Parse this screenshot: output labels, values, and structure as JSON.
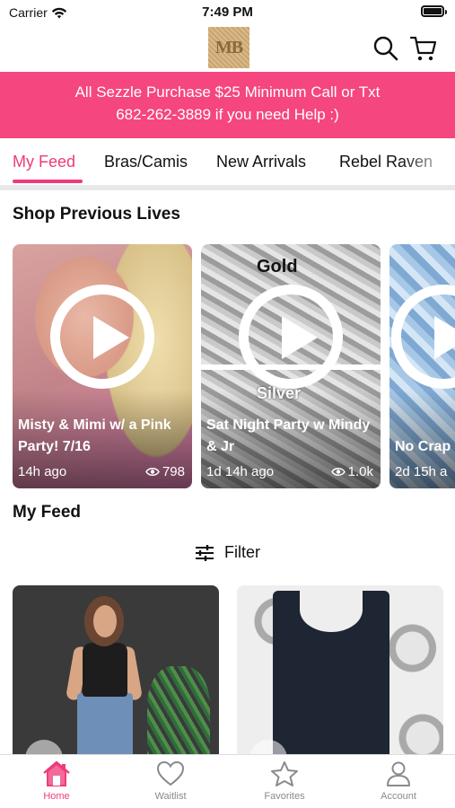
{
  "status_bar": {
    "carrier": "Carrier",
    "time": "7:49 PM"
  },
  "header": {
    "logo_text": "MB"
  },
  "banner": {
    "line1": "All Sezzle Purchase $25 Minimum  Call or Txt",
    "line2": "682-262-3889 if  you need Help :)"
  },
  "tabs": [
    "My Feed",
    "Bras/Camis",
    "New Arrivals",
    "Rebel Raven"
  ],
  "active_tab": "My Feed",
  "previous_lives": {
    "title": "Shop Previous Lives",
    "cards": [
      {
        "title": "Misty & Mimi w/ a Pink Party! 7/16",
        "ago": "14h ago",
        "views": "798"
      },
      {
        "title": "Sat Night Party w Mindy & Jr",
        "ago": "1d 14h ago",
        "views": "1.0k",
        "overlay_top": "Gold",
        "overlay_bottom": "Silver"
      },
      {
        "title": "No Crap",
        "ago": "2d 15h a",
        "views": ""
      }
    ]
  },
  "feed": {
    "title": "My Feed",
    "filter_label": "Filter"
  },
  "bottom_nav": [
    {
      "label": "Home",
      "icon": "home-icon",
      "active": true
    },
    {
      "label": "Waitlist",
      "icon": "heart-icon",
      "active": false
    },
    {
      "label": "Favorites",
      "icon": "star-icon",
      "active": false
    },
    {
      "label": "Account",
      "icon": "account-icon",
      "active": false
    }
  ],
  "colors": {
    "accent": "#ee3b7c",
    "banner": "#f5467f",
    "inactive": "#8a8a8e"
  }
}
